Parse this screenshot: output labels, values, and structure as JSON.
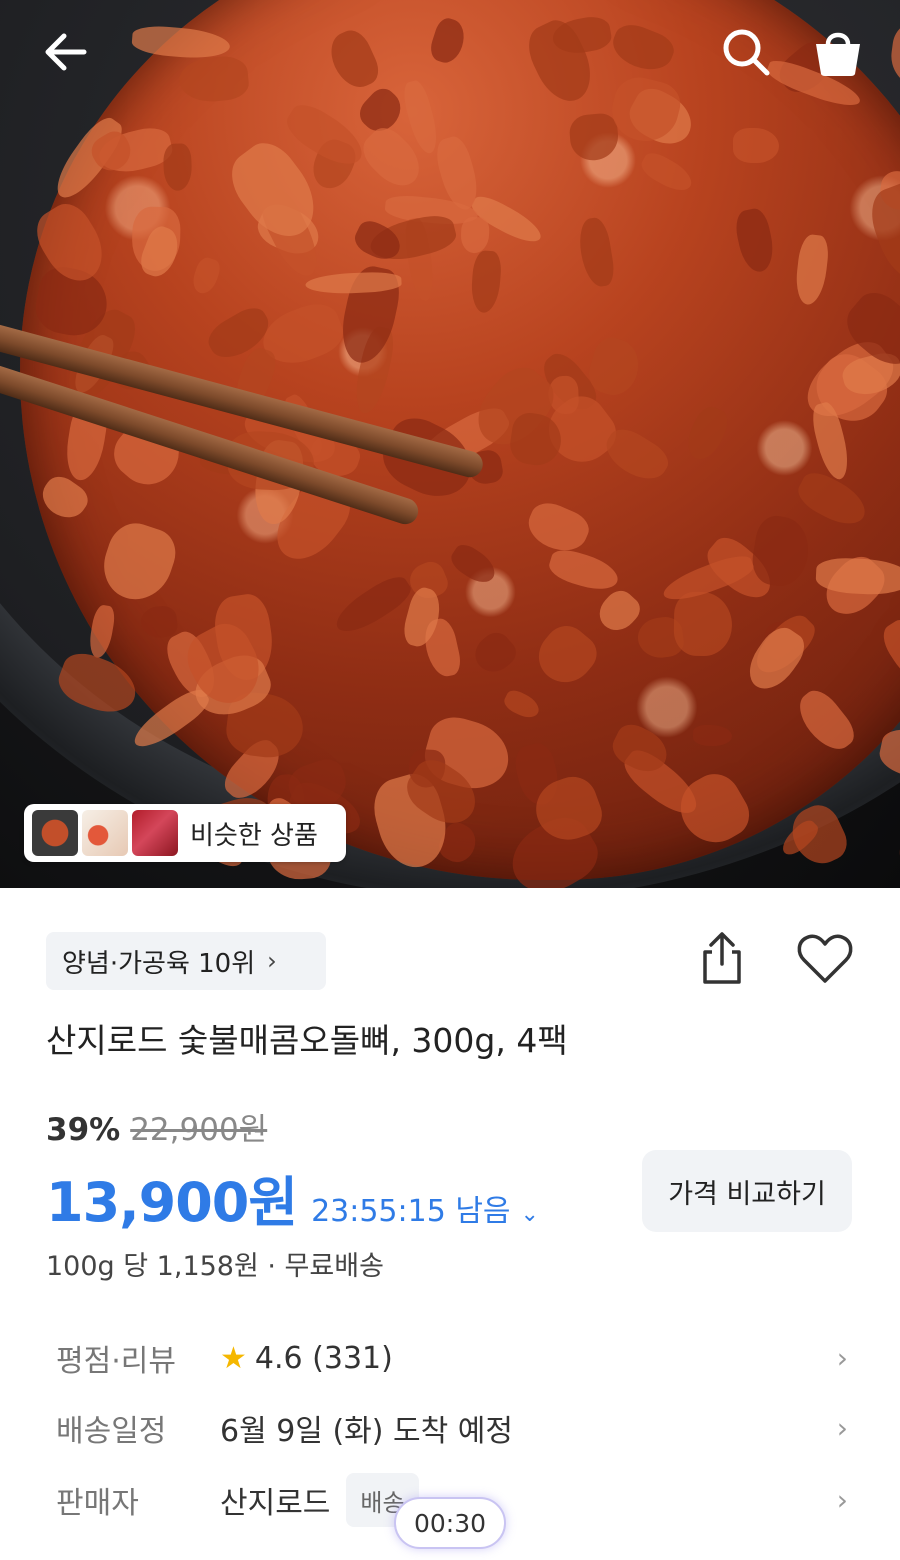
{
  "header": {
    "back_icon": "arrow-left-icon",
    "search_icon": "search-icon",
    "cart_icon": "shopping-bag-icon"
  },
  "hero": {
    "similar_label": "비슷한 상품"
  },
  "product": {
    "rank_label": "양념·가공육 10위",
    "title": "산지로드 숯불매콤오돌뼈, 300g, 4팩",
    "discount_rate": "39%",
    "original_price": "22,900원",
    "sale_price": "13,900원",
    "countdown": "23:55:15 남음",
    "compare_label": "가격 비교하기",
    "unit_price": "100g 당 1,158원 · 무료배송"
  },
  "details": {
    "rating_label": "평점·리뷰",
    "rating_value": "4.6 (331)",
    "delivery_label": "배송일정",
    "delivery_value": "6월 9일 (화) 도착 예정",
    "seller_label": "판매자",
    "seller_value": "산지로드",
    "seller_badge": "배송"
  },
  "overlay": {
    "timer": "00:30"
  },
  "colors": {
    "accent": "#2f7be6",
    "star": "#f5b700"
  }
}
